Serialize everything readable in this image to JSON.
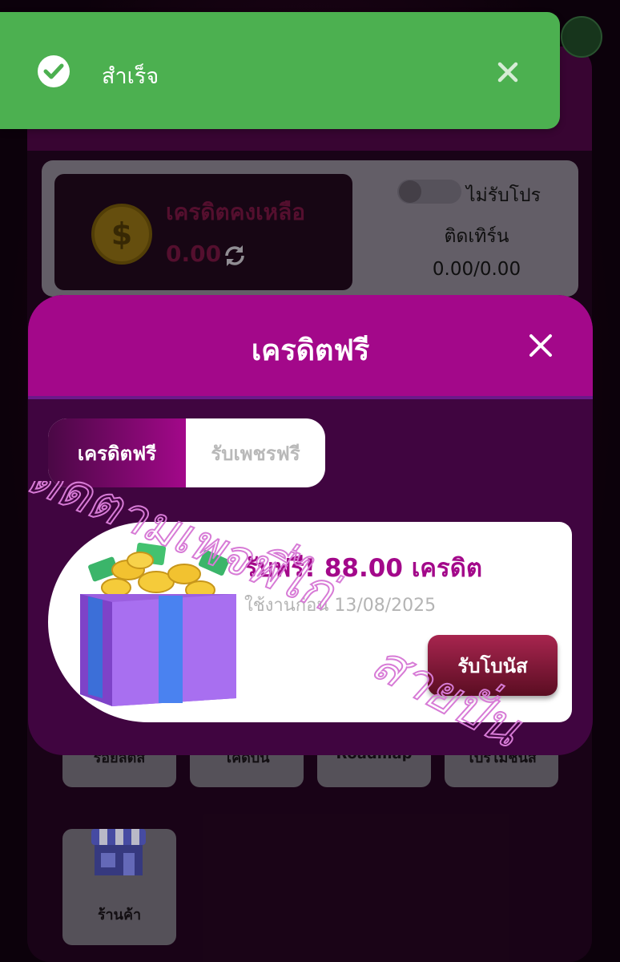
{
  "toast": {
    "message": "สำเร็จ",
    "icon": "check-circle-icon",
    "close_icon": "close-icon",
    "color": "#4cb050"
  },
  "balance": {
    "title": "เครดิตคงเหลือ",
    "amount": "0.00",
    "coin_symbol": "$",
    "promo_toggle_label": "ไม่รับโปร",
    "promo_toggle_on": false,
    "turnover_label": "ติดเทิร์น",
    "turnover_value": "0.00/0.00"
  },
  "menu_tiles": [
    {
      "label": "รอยัลตี้ส"
    },
    {
      "label": "โค้ดบัน"
    },
    {
      "label": "Roadmap"
    },
    {
      "label": "โปรโมชั่นส"
    },
    {
      "label": "ร้านค้า"
    }
  ],
  "modal": {
    "title": "เครดิตฟรี",
    "close_icon": "close-icon",
    "tabs": [
      {
        "label": "เครดิตฟรี",
        "active": true
      },
      {
        "label": "รับเพชรฟรี",
        "active": false
      }
    ],
    "bonus": {
      "title": "รับฟรี! 88.00 เครดิต",
      "expire": "ใช้งานก่อน 13/08/2025",
      "button_label": "รับโบนัส",
      "image_icon": "gift-box-icon"
    }
  },
  "watermark": {
    "line1": "ติดตามเพจพี่ไก่",
    "line2": "สายปั่น"
  },
  "colors": {
    "accent": "#a3088a",
    "modal_bg": "#400540",
    "button_dark": "#5a0d22",
    "success": "#4cb050"
  }
}
